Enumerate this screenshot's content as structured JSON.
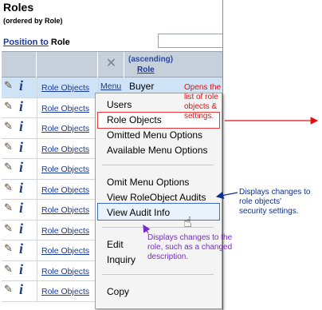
{
  "panel": {
    "title": "Roles",
    "subtitle": "(ordered by Role)",
    "position_link": "Position to",
    "position_label": "Role"
  },
  "table": {
    "header": {
      "sort_note": "(ascending)",
      "sort_column": "Role",
      "clear_icon": "x-icon"
    },
    "row_link": "Role Objects",
    "menu_link": "Menu",
    "selected_role": "Buyer",
    "row_count": 11
  },
  "context_menu": {
    "items": [
      "Users",
      "Role Objects",
      "Omitted Menu Options",
      "Available Menu Options",
      "Omit Menu Options",
      "View RoleObject Audits",
      "View Audit Info",
      "Edit",
      "Inquiry",
      "Copy"
    ],
    "highlight_red_item": "Role Objects",
    "hover_item": "View Audit Info"
  },
  "annotations": {
    "red": [
      "Opens the",
      "list of role",
      "objects &",
      "settings."
    ],
    "blue": [
      "Displays changes to",
      "role objects'",
      "security settings."
    ],
    "purple": [
      "Displays changes to the",
      "role, such as a changed",
      "description."
    ]
  },
  "colors": {
    "red_note": "#e01010",
    "blue_note": "#10308c",
    "purple_note": "#7a2ac8",
    "header_bg": "#c5d0db",
    "selected_row": "#cfe3f6"
  }
}
